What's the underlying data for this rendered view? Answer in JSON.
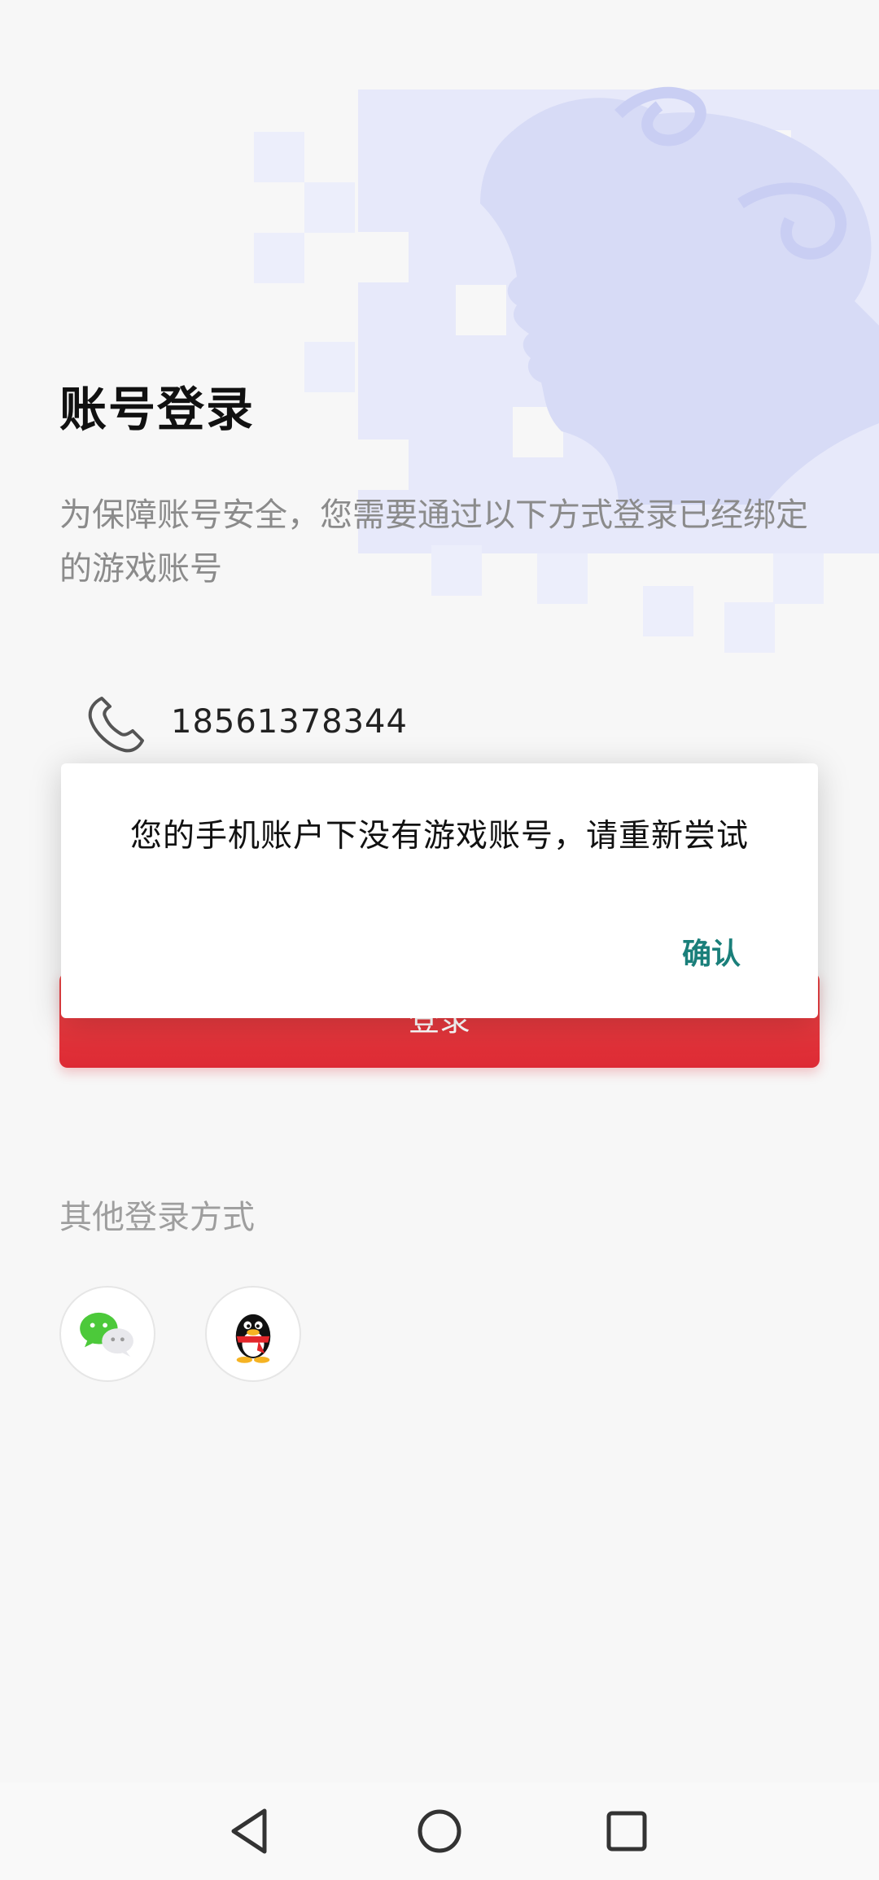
{
  "page": {
    "title": "账号登录",
    "subtitle": "为保障账号安全，您需要通过以下方式登录已经绑定的游戏账号"
  },
  "account": {
    "phone_number": "18561378344",
    "phone_icon": "phone-icon"
  },
  "login_button": {
    "label": "登录"
  },
  "dialog": {
    "message": "您的手机账户下没有游戏账号，请重新尝试",
    "confirm_label": "确认"
  },
  "other_login": {
    "label": "其他登录方式",
    "options": [
      "wechat-icon",
      "qq-icon"
    ]
  },
  "nav_bar": {
    "icons": [
      "back-triangle-icon",
      "home-circle-icon",
      "recent-square-icon"
    ]
  },
  "colors": {
    "accent_red": "#e0303a",
    "confirm_teal": "#1a7f7a",
    "hero_tint": "#dfe2f8"
  }
}
